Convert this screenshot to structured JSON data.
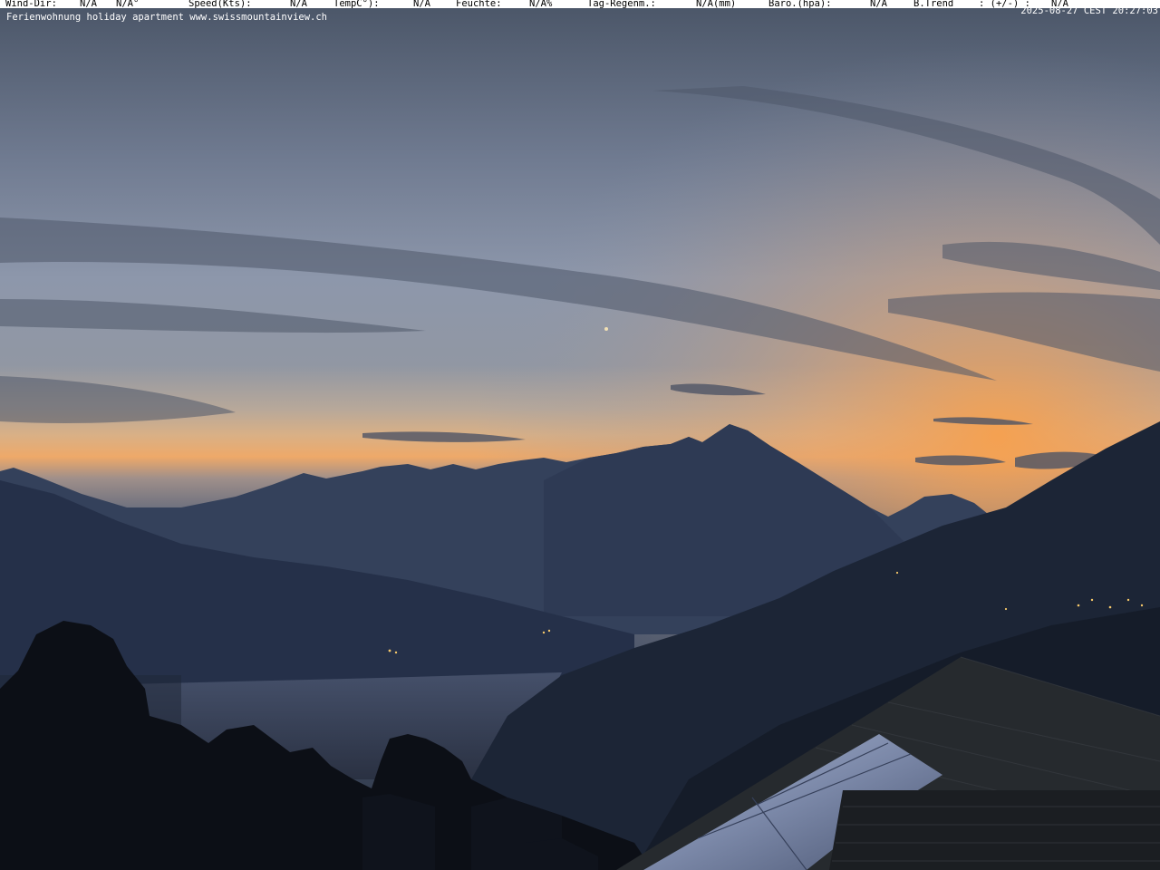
{
  "weather": {
    "wind_dir_label": "Wind-Dir:",
    "wind_dir_value": "N/A",
    "wind_deg_value": "N/A°",
    "speed_label": "Speed(Kts):",
    "speed_value": "N/A",
    "temp_label": "TempC°):",
    "temp_value": "N/A",
    "humidity_label": "Feuchte:",
    "humidity_value": "N/A%",
    "rain_label": "Tag-Regenm.:",
    "rain_value": "N/A(mm)",
    "baro_label": "Baro.(hpa):",
    "baro_value": "N/A",
    "trend_label": "B.Trend",
    "trend_sep": ": (+/-) :",
    "trend_value": "N/A"
  },
  "overlay": {
    "caption": "Ferienwohnung holiday apartment www.swissmountainview.ch",
    "timestamp": "2025-08-27 CEST 20:27:03"
  },
  "colors": {
    "sky_top": "#4a5567",
    "sky_mid": "#8d97ab",
    "horizon_glow": "#f1a45c",
    "mountains": "#2c3952",
    "lake": "#3b465a",
    "foreground": "#0c0f16"
  }
}
